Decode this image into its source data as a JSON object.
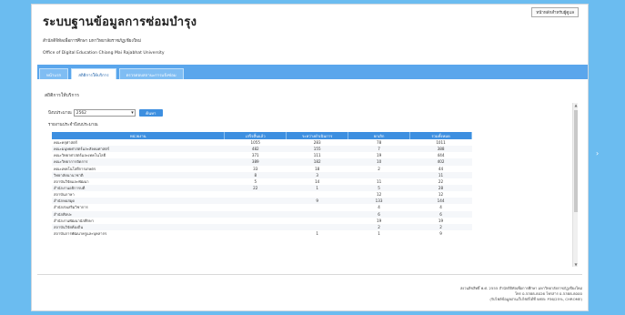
{
  "header": {
    "title": "ระบบฐานข้อมูลการซ่อมบำรุง",
    "subtitle_th": "สำนักดิจิทัลเพื่อการศึกษา มหาวิทยาลัยราชภัฏเชียงใหม่",
    "subtitle_en": "Office of Digital Education Chiang Mai Rajabhat University",
    "help_link": "หน้าหลักสำหรับผู้ดูแล"
  },
  "tabs": [
    {
      "label": "หน้าแรก",
      "active": false
    },
    {
      "label": "สถิติการให้บริการ",
      "active": true
    },
    {
      "label": "ตรวจสอบสถานะการแจ้งซ่อม",
      "active": false
    }
  ],
  "main": {
    "section_title": "สถิติการให้บริการ",
    "filter_label": "ปีงบประมาณ",
    "filter_value": "2562",
    "search_button": "ค้นหา",
    "table_caption": "รายงานประจำปีงบประมาณ"
  },
  "table": {
    "headers": [
      "หน่วยงาน",
      "เสร็จสิ้นแล้ว",
      "ระหว่างดำเนินการ",
      "ยกเลิก",
      "รวมทั้งหมด"
    ],
    "rows": [
      [
        "คณะครุศาสตร์",
        "1055",
        "283",
        "78",
        "1011"
      ],
      [
        "คณะมนุษยศาสตร์และสังคมศาสตร์",
        "482",
        "155",
        "7",
        "388"
      ],
      [
        "คณะวิทยาศาสตร์และเทคโนโลยี",
        "371",
        "111",
        "19",
        "444"
      ],
      [
        "คณะวิทยาการจัดการ",
        "389",
        "182",
        "10",
        "402"
      ],
      [
        "คณะเทคโนโลยีการเกษตร",
        "33",
        "18",
        "2",
        "44"
      ],
      [
        "วิทยาลัยนานาชาติ",
        "8",
        "3",
        "",
        "11"
      ],
      [
        "สถาบันวิจัยและพัฒนา",
        "5",
        "14",
        "11",
        "22"
      ],
      [
        "สำนักงานอธิการบดี",
        "22",
        "1",
        "5",
        "28"
      ],
      [
        "สถาบันภาษา",
        "",
        "",
        "12",
        "12"
      ],
      [
        "สำนักหอสมุด",
        "",
        "9",
        "133",
        "144"
      ],
      [
        "สำนักส่งเสริมวิชาการ",
        "",
        "",
        "4",
        "4"
      ],
      [
        "สำนักศิลปะ",
        "",
        "",
        "6",
        "6"
      ],
      [
        "สำนักงานพัฒนานักศึกษา",
        "",
        "",
        "19",
        "19"
      ],
      [
        "สถาบันวิจัยท้องถิ่น",
        "",
        "",
        "2",
        "2"
      ],
      [
        "สถาบันการพัฒนาครูและบุคลากร",
        "",
        "1",
        "1",
        "9"
      ]
    ]
  },
  "footer": {
    "line1": "สงวนลิขสิทธิ์ พ.ศ. 2555 สำนักดิจิทัลเพื่อการศึกษา มหาวิทยาลัยราชภัฏเชียงใหม่",
    "line2": "โทร 0-5388-8026 โทรสาร 0-5388-8000",
    "line3": "(รับไฟล์ข้อมูลผ่านเว็บไซต์ได้ที่ WEB: P36/25%, CHROME)"
  }
}
